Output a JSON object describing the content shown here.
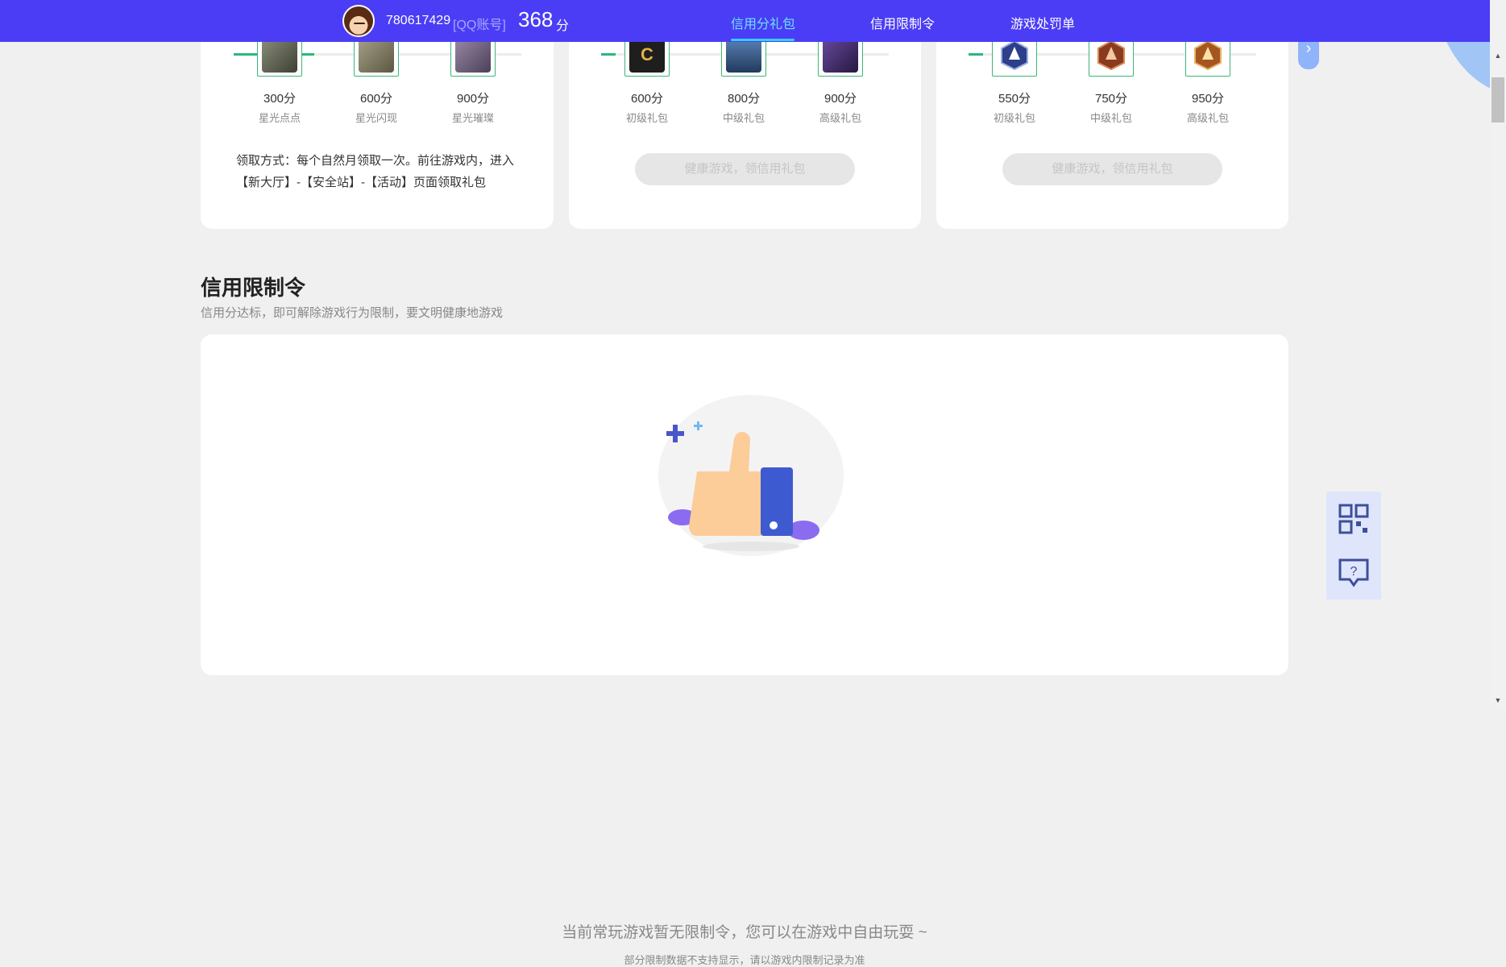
{
  "topbar": {
    "user_id": "780617429",
    "user_tag": "[QQ账号]",
    "score": "368",
    "score_unit": "分",
    "nav": [
      {
        "label": "信用分礼包",
        "active": true
      },
      {
        "label": "信用限制令",
        "active": false
      },
      {
        "label": "游戏处罚单",
        "active": false
      }
    ]
  },
  "cards": [
    {
      "gifts": [
        {
          "value": "300分",
          "name": "星光点点"
        },
        {
          "value": "600分",
          "name": "星光闪现"
        },
        {
          "value": "900分",
          "name": "星光璀璨"
        }
      ],
      "note": "领取方式：每个自然月领取一次。前往游戏内，进入【新大厅】-【安全站】-【活动】页面领取礼包"
    },
    {
      "gifts": [
        {
          "value": "600分",
          "name": "初级礼包"
        },
        {
          "value": "800分",
          "name": "中级礼包"
        },
        {
          "value": "900分",
          "name": "高级礼包"
        }
      ],
      "button": "健康游戏，领信用礼包"
    },
    {
      "gifts": [
        {
          "value": "550分",
          "name": "初级礼包"
        },
        {
          "value": "750分",
          "name": "中级礼包"
        },
        {
          "value": "950分",
          "name": "高级礼包"
        }
      ],
      "button": "健康游戏，领信用礼包"
    }
  ],
  "restriction": {
    "title": "信用限制令",
    "subtitle": "信用分达标，即可解除游戏行为限制，要文明健康地游戏",
    "empty_main": "当前常玩游戏暂无限制令，您可以在游戏中自由玩耍 ~",
    "empty_sub": "部分限制数据不支持显示，请以游戏内限制记录为准"
  },
  "side_tools": [
    {
      "icon": "qr-code-icon"
    },
    {
      "icon": "feedback-question-icon"
    }
  ],
  "colors": {
    "topbar": "#4a3df5",
    "active_nav": "#6fe0ff",
    "progress": "#2bb87a",
    "page_bg": "#f0f0f0"
  }
}
